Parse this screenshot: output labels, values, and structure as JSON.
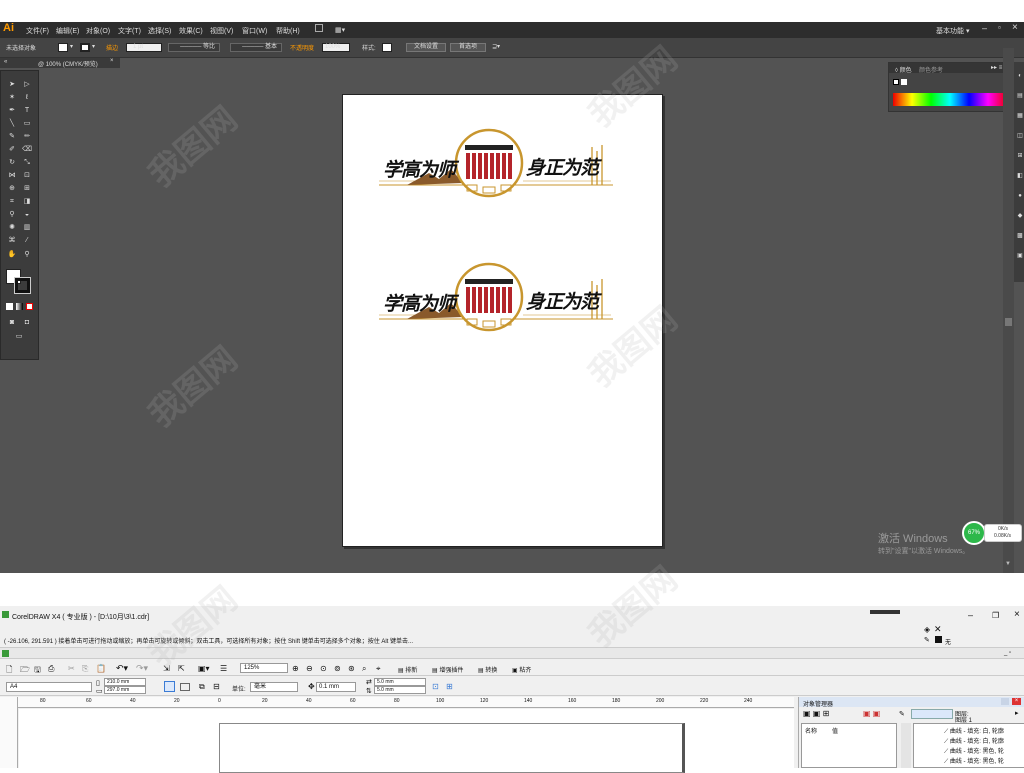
{
  "ai": {
    "logo": "Ai",
    "menu": [
      "文件(F)",
      "编辑(E)",
      "对象(O)",
      "文字(T)",
      "选择(S)",
      "效果(C)",
      "视图(V)",
      "窗口(W)",
      "帮助(H)"
    ],
    "workspace": "基本功能",
    "control": {
      "no_selection": "未选择对象",
      "stroke_label": "描边",
      "stroke_value": "1 pt",
      "profile": "等比",
      "brush": "基本",
      "opacity_label": "不透明度",
      "opacity_value": "100%",
      "style_label": "样式",
      "doc_setup": "文档设置",
      "preferences": "首选项"
    },
    "doc_tab": "@ 100% (CMYK/预览)",
    "color_panel": {
      "tab1": "颜色",
      "tab2": "颜色参考"
    },
    "artboard": {
      "emblem_left": "学高为师",
      "emblem_right": "身正为范"
    },
    "win_activation": {
      "title": "激活 Windows",
      "subtitle": "转到\"设置\"以激活 Windows。"
    },
    "net": {
      "percent": "67%",
      "up": "0K/s",
      "down": "0.08K/s"
    },
    "colors": {
      "accent": "#ff9a00",
      "gold": "#c8962e",
      "red": "#b4242a"
    }
  },
  "cd": {
    "title": "CorelDRAW X4 ( 专业版 ) - [D:\\10月\\3\\1.cdr]",
    "status": "( -26.106, 291.591 )    接着单击可进行拖动或缩放；再单击可旋转或倾斜；双击工具，可选择所有对象；按住 Shift 键单击可选择多个对象；按住 Alt 键单击...",
    "zoom": "125%",
    "toolbar_items": [
      "排新",
      "增强插件",
      "转换",
      "粘齐"
    ],
    "page_size": "A4",
    "width": "210.0 mm",
    "height": "297.0 mm",
    "unit_label": "单位:",
    "unit": "毫米",
    "nudge": "0.1 mm",
    "dup_x": "5.0 mm",
    "dup_y": "5.0 mm",
    "ruler_ticks": [
      "80",
      "60",
      "40",
      "20",
      "0",
      "20",
      "40",
      "60",
      "80",
      "100",
      "120",
      "140",
      "160",
      "180",
      "200",
      "220",
      "240"
    ],
    "object_manager": "对象管理器",
    "col_name": "名称",
    "col_value": "值",
    "layers": [
      "图层:",
      "图层 1"
    ],
    "objects": [
      "曲线 - 填充: 白, 轮廓",
      "曲线 - 填充: 白, 轮廓",
      "曲线 - 填充: 黑色, 轮",
      "曲线 - 填充: 黑色, 轮"
    ],
    "fill_none": "无"
  },
  "watermark": "我图网"
}
